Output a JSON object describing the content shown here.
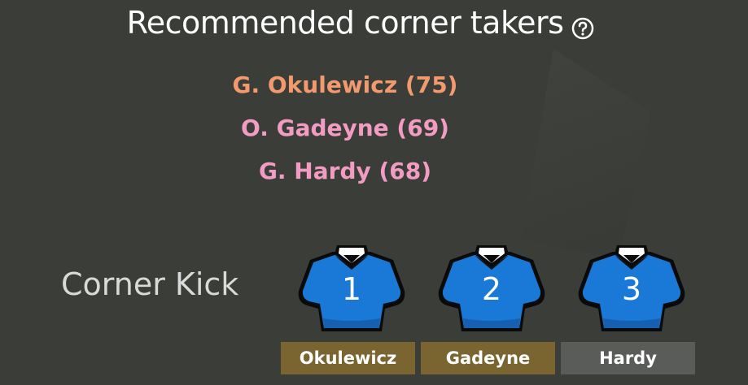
{
  "title": "Recommended corner takers",
  "help_icon": "help-circle-icon",
  "recommended": [
    {
      "text": "G. Okulewicz (75)",
      "color": "#f29a6e"
    },
    {
      "text": "O. Gadeyne (69)",
      "color": "#f29cc4"
    },
    {
      "text": "G. Hardy (68)",
      "color": "#f29cc4"
    }
  ],
  "corner_label": "Corner Kick",
  "colors": {
    "shirt": "#1a78d6",
    "gold_slot": "#7a6530",
    "gray_slot": "#5a5c5a",
    "background": "#3a3d38"
  },
  "slots": [
    {
      "number": "1",
      "name": "Okulewicz",
      "icon": "jersey-icon"
    },
    {
      "number": "2",
      "name": "Gadeyne",
      "icon": "jersey-icon"
    },
    {
      "number": "3",
      "name": "Hardy",
      "icon": "jersey-icon"
    }
  ]
}
